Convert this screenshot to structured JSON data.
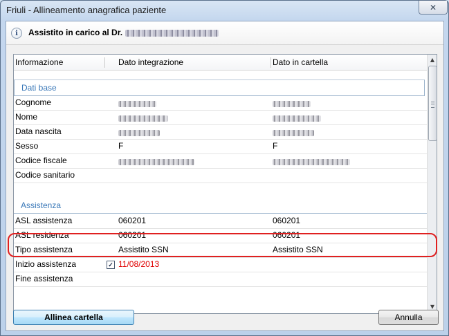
{
  "window": {
    "title": "Friuli - Allineamento anagrafica paziente",
    "close_glyph": "✕"
  },
  "header": {
    "title": "Assistito in carico al Dr.",
    "info_glyph": "i"
  },
  "grid": {
    "columns": [
      "Informazione",
      "Dato integrazione",
      "Dato in cartella"
    ],
    "sections": [
      {
        "label": "Dati base",
        "rows": [
          {
            "label": "Cognome",
            "integrazione": "",
            "cartella": ""
          },
          {
            "label": "Nome",
            "integrazione": "",
            "cartella": ""
          },
          {
            "label": "Data nascita",
            "integrazione": "",
            "cartella": ""
          },
          {
            "label": "Sesso",
            "integrazione": "F",
            "cartella": "F"
          },
          {
            "label": "Codice fiscale",
            "integrazione": "",
            "cartella": ""
          },
          {
            "label": "Codice sanitario",
            "integrazione": "",
            "cartella": ""
          }
        ]
      },
      {
        "label": "Assistenza",
        "rows": [
          {
            "label": "ASL assistenza",
            "integrazione": "060201",
            "cartella": "060201"
          },
          {
            "label": "ASL residenza",
            "integrazione": "060201",
            "cartella": "060201"
          },
          {
            "label": "Tipo assistenza",
            "integrazione": "Assistito SSN",
            "cartella": "Assistito SSN"
          },
          {
            "label": "Inizio assistenza",
            "integrazione": "11/08/2013",
            "cartella": "",
            "checked": true,
            "check_glyph": "✓"
          },
          {
            "label": "Fine assistenza",
            "integrazione": "",
            "cartella": ""
          }
        ]
      }
    ],
    "highlight_color": "#e02020",
    "diff_color": "#e00000"
  },
  "scrollbar": {
    "up_glyph": "▲",
    "down_glyph": "▼"
  },
  "buttons": {
    "allinea": "Allinea cartella",
    "chiudi": "Annulla"
  }
}
